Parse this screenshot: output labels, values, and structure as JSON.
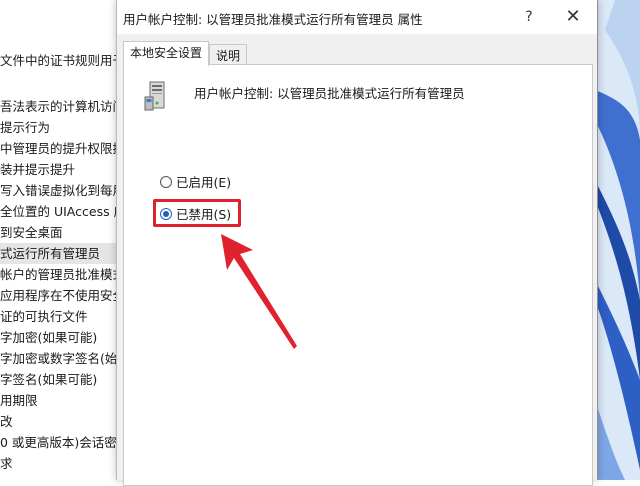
{
  "background_list": {
    "items": [
      {
        "label": "文件中的证书规则用于"
      },
      {
        "label": "吾法表示的计算机访问"
      },
      {
        "label": "提示行为"
      },
      {
        "label": "中管理员的提升权限提"
      },
      {
        "label": "装并提示提升"
      },
      {
        "label": "写入错误虚拟化到每用"
      },
      {
        "label": "全位置的 UIAccess 应"
      },
      {
        "label": "到安全桌面"
      },
      {
        "label": "式运行所有管理员"
      },
      {
        "label": "帐户的管理员批准模式"
      },
      {
        "label": "应用程序在不使用安全"
      },
      {
        "label": "证的可执行文件"
      },
      {
        "label": "字加密(如果可能)"
      },
      {
        "label": "字加密或数字签名(始"
      },
      {
        "label": "字签名(如果可能)"
      },
      {
        "label": "用期限"
      },
      {
        "label": "改"
      },
      {
        "label": "0 或更高版本)会话密"
      },
      {
        "label": "求"
      }
    ],
    "selected_index": 8
  },
  "dialog": {
    "title": "用户帐户控制: 以管理员批准模式运行所有管理员 属性",
    "help_glyph": "?",
    "close_glyph": "✕",
    "tabs": [
      {
        "label": "本地安全设置"
      },
      {
        "label": "说明"
      }
    ],
    "active_tab": 0,
    "policy_name": "用户帐户控制: 以管理员批准模式运行所有管理员",
    "options": {
      "enabled_label": "已启用(E)",
      "disabled_label": "已禁用(S)",
      "selected": "disabled"
    }
  },
  "colors": {
    "annotation_red": "#e0222e",
    "radio_blue": "#1f5fbf"
  }
}
